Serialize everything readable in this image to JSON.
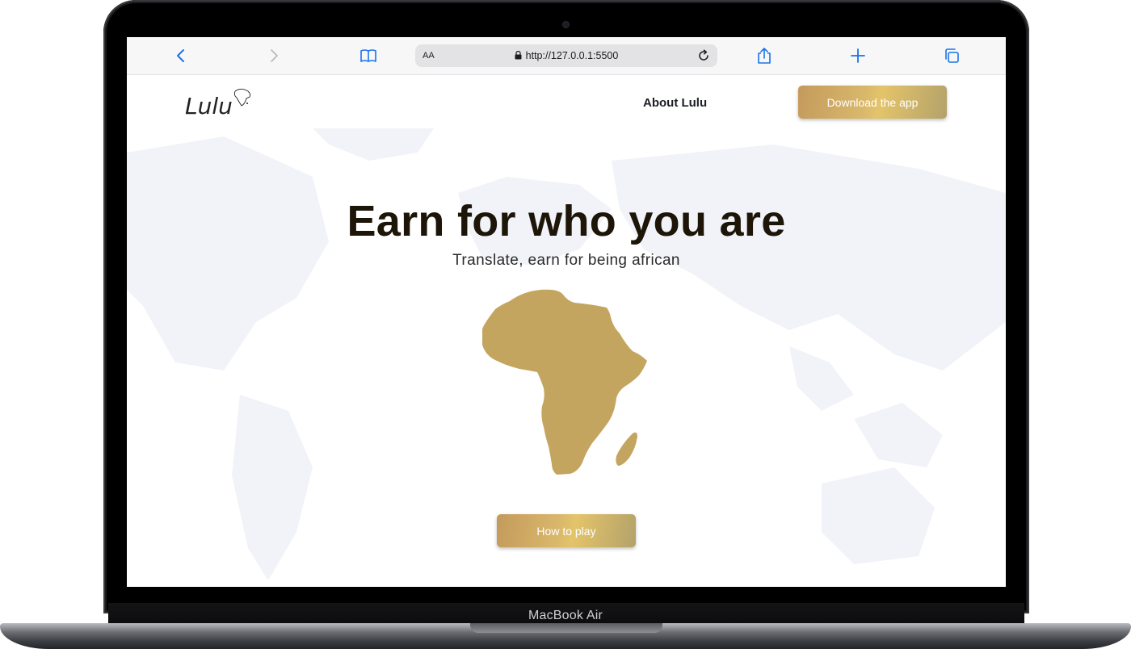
{
  "device": {
    "label": "MacBook Air"
  },
  "browser": {
    "text_size_label": "AA",
    "url": "http://127.0.0.1:5500",
    "icons": [
      "back-icon",
      "forward-icon",
      "bookmarks-icon",
      "lock-icon",
      "reload-icon",
      "share-icon",
      "new-tab-icon",
      "tabs-icon"
    ]
  },
  "nav": {
    "logo_text": "Lulu",
    "about_label": "About Lulu",
    "download_label": "Download the app"
  },
  "hero": {
    "title": "Earn for who you are",
    "subtitle": "Translate, earn for being african",
    "cta_label": "How to play"
  },
  "colors": {
    "gold": "#c4a560",
    "button_gradient_start": "#c49a5c",
    "button_gradient_end": "#b3a26a",
    "title": "#1c1508",
    "browser_accent": "#1a73e8"
  }
}
